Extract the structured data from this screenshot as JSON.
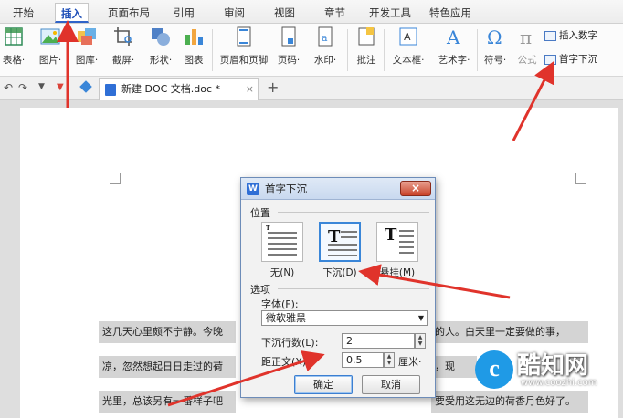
{
  "menu": {
    "tabs": [
      "开始",
      "插入",
      "页面布局",
      "引用",
      "审阅",
      "视图",
      "章节",
      "开发工具",
      "特色应用"
    ],
    "active": "插入"
  },
  "ribbon": {
    "buttons": [
      {
        "label": "表格·",
        "icon": "table-icon"
      },
      {
        "label": "图片·",
        "icon": "picture-icon"
      },
      {
        "label": "图库·",
        "icon": "gallery-icon"
      },
      {
        "label": "截屏·",
        "icon": "screenshot-icon"
      },
      {
        "label": "形状·",
        "icon": "shape-icon"
      },
      {
        "label": "图表",
        "icon": "chart-icon"
      },
      {
        "label": "页眉和页脚",
        "icon": "header-footer-icon"
      },
      {
        "label": "页码·",
        "icon": "page-number-icon"
      },
      {
        "label": "水印·",
        "icon": "watermark-icon"
      },
      {
        "label": "批注",
        "icon": "comment-icon"
      },
      {
        "label": "文本框·",
        "icon": "textbox-icon"
      },
      {
        "label": "艺术字·",
        "icon": "wordart-icon"
      },
      {
        "label": "符号·",
        "icon": "symbol-icon"
      },
      {
        "label": "公式",
        "icon": "formula-icon"
      }
    ],
    "small": [
      "插入数字",
      "首字下沉"
    ]
  },
  "docbar": {
    "tab_title": "新建 DOC 文档.doc *",
    "close": "×",
    "add": "+"
  },
  "document": {
    "lines": [
      "这几天心里颇不宁静。今晚",
      "的人。白天里一定要做的事，",
      "凉，忽然想起日日走过的荷",
      "，现",
      "光里，总该另有一番样子吧",
      "要受用这无边的荷香月色好了。"
    ]
  },
  "dialog": {
    "title": "首字下沉",
    "close": "×",
    "position_group": "位置",
    "options": [
      {
        "caption": "无(N)"
      },
      {
        "caption": "下沉(D)"
      },
      {
        "caption": "悬挂(M)"
      }
    ],
    "options_group": "选项",
    "font_label": "字体(F):",
    "font_value": "微软雅黑",
    "lines_label": "下沉行数(L):",
    "lines_value": "2",
    "distance_label": "距正文(X):",
    "distance_value": "0.5",
    "distance_unit": "厘米·",
    "ok": "确定",
    "cancel": "取消"
  },
  "watermark": {
    "text": "酷知网",
    "url": "www.coozhi.com",
    "logo": "c"
  },
  "colors": {
    "accent": "#2f63c8",
    "arrow": "#e0332b",
    "selected_border": "#3a86d8"
  }
}
